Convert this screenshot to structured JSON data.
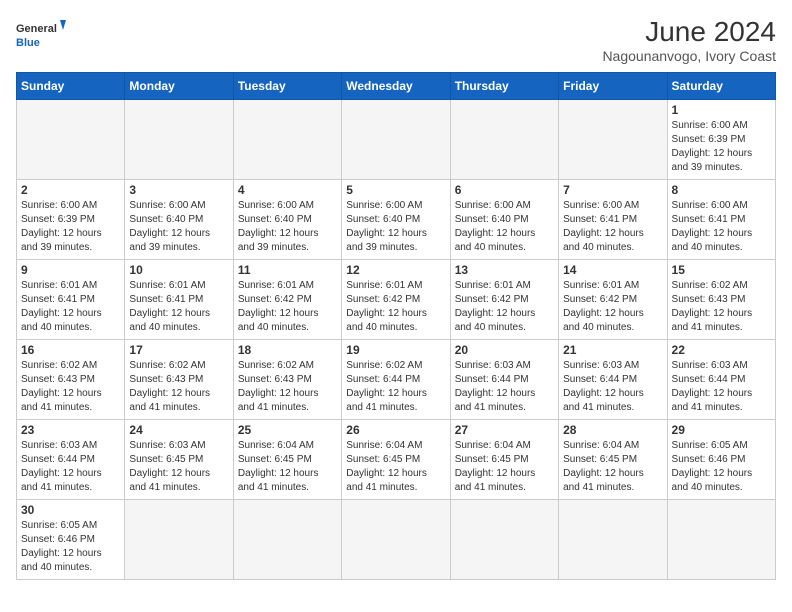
{
  "header": {
    "logo_general": "General",
    "logo_blue": "Blue",
    "title": "June 2024",
    "subtitle": "Nagounanvogo, Ivory Coast"
  },
  "weekdays": [
    "Sunday",
    "Monday",
    "Tuesday",
    "Wednesday",
    "Thursday",
    "Friday",
    "Saturday"
  ],
  "weeks": [
    [
      {
        "day": "",
        "info": "",
        "empty": true
      },
      {
        "day": "",
        "info": "",
        "empty": true
      },
      {
        "day": "",
        "info": "",
        "empty": true
      },
      {
        "day": "",
        "info": "",
        "empty": true
      },
      {
        "day": "",
        "info": "",
        "empty": true
      },
      {
        "day": "",
        "info": "",
        "empty": true
      },
      {
        "day": "1",
        "info": "Sunrise: 6:00 AM\nSunset: 6:39 PM\nDaylight: 12 hours\nand 39 minutes."
      }
    ],
    [
      {
        "day": "2",
        "info": "Sunrise: 6:00 AM\nSunset: 6:39 PM\nDaylight: 12 hours\nand 39 minutes."
      },
      {
        "day": "3",
        "info": "Sunrise: 6:00 AM\nSunset: 6:40 PM\nDaylight: 12 hours\nand 39 minutes."
      },
      {
        "day": "4",
        "info": "Sunrise: 6:00 AM\nSunset: 6:40 PM\nDaylight: 12 hours\nand 39 minutes."
      },
      {
        "day": "5",
        "info": "Sunrise: 6:00 AM\nSunset: 6:40 PM\nDaylight: 12 hours\nand 39 minutes."
      },
      {
        "day": "6",
        "info": "Sunrise: 6:00 AM\nSunset: 6:40 PM\nDaylight: 12 hours\nand 40 minutes."
      },
      {
        "day": "7",
        "info": "Sunrise: 6:00 AM\nSunset: 6:41 PM\nDaylight: 12 hours\nand 40 minutes."
      },
      {
        "day": "8",
        "info": "Sunrise: 6:00 AM\nSunset: 6:41 PM\nDaylight: 12 hours\nand 40 minutes."
      }
    ],
    [
      {
        "day": "9",
        "info": "Sunrise: 6:01 AM\nSunset: 6:41 PM\nDaylight: 12 hours\nand 40 minutes."
      },
      {
        "day": "10",
        "info": "Sunrise: 6:01 AM\nSunset: 6:41 PM\nDaylight: 12 hours\nand 40 minutes."
      },
      {
        "day": "11",
        "info": "Sunrise: 6:01 AM\nSunset: 6:42 PM\nDaylight: 12 hours\nand 40 minutes."
      },
      {
        "day": "12",
        "info": "Sunrise: 6:01 AM\nSunset: 6:42 PM\nDaylight: 12 hours\nand 40 minutes."
      },
      {
        "day": "13",
        "info": "Sunrise: 6:01 AM\nSunset: 6:42 PM\nDaylight: 12 hours\nand 40 minutes."
      },
      {
        "day": "14",
        "info": "Sunrise: 6:01 AM\nSunset: 6:42 PM\nDaylight: 12 hours\nand 40 minutes."
      },
      {
        "day": "15",
        "info": "Sunrise: 6:02 AM\nSunset: 6:43 PM\nDaylight: 12 hours\nand 41 minutes."
      }
    ],
    [
      {
        "day": "16",
        "info": "Sunrise: 6:02 AM\nSunset: 6:43 PM\nDaylight: 12 hours\nand 41 minutes."
      },
      {
        "day": "17",
        "info": "Sunrise: 6:02 AM\nSunset: 6:43 PM\nDaylight: 12 hours\nand 41 minutes."
      },
      {
        "day": "18",
        "info": "Sunrise: 6:02 AM\nSunset: 6:43 PM\nDaylight: 12 hours\nand 41 minutes."
      },
      {
        "day": "19",
        "info": "Sunrise: 6:02 AM\nSunset: 6:44 PM\nDaylight: 12 hours\nand 41 minutes."
      },
      {
        "day": "20",
        "info": "Sunrise: 6:03 AM\nSunset: 6:44 PM\nDaylight: 12 hours\nand 41 minutes."
      },
      {
        "day": "21",
        "info": "Sunrise: 6:03 AM\nSunset: 6:44 PM\nDaylight: 12 hours\nand 41 minutes."
      },
      {
        "day": "22",
        "info": "Sunrise: 6:03 AM\nSunset: 6:44 PM\nDaylight: 12 hours\nand 41 minutes."
      }
    ],
    [
      {
        "day": "23",
        "info": "Sunrise: 6:03 AM\nSunset: 6:44 PM\nDaylight: 12 hours\nand 41 minutes."
      },
      {
        "day": "24",
        "info": "Sunrise: 6:03 AM\nSunset: 6:45 PM\nDaylight: 12 hours\nand 41 minutes."
      },
      {
        "day": "25",
        "info": "Sunrise: 6:04 AM\nSunset: 6:45 PM\nDaylight: 12 hours\nand 41 minutes."
      },
      {
        "day": "26",
        "info": "Sunrise: 6:04 AM\nSunset: 6:45 PM\nDaylight: 12 hours\nand 41 minutes."
      },
      {
        "day": "27",
        "info": "Sunrise: 6:04 AM\nSunset: 6:45 PM\nDaylight: 12 hours\nand 41 minutes."
      },
      {
        "day": "28",
        "info": "Sunrise: 6:04 AM\nSunset: 6:45 PM\nDaylight: 12 hours\nand 41 minutes."
      },
      {
        "day": "29",
        "info": "Sunrise: 6:05 AM\nSunset: 6:46 PM\nDaylight: 12 hours\nand 40 minutes."
      }
    ],
    [
      {
        "day": "30",
        "info": "Sunrise: 6:05 AM\nSunset: 6:46 PM\nDaylight: 12 hours\nand 40 minutes.",
        "last": true
      },
      {
        "day": "",
        "info": "",
        "empty": true,
        "last": true
      },
      {
        "day": "",
        "info": "",
        "empty": true,
        "last": true
      },
      {
        "day": "",
        "info": "",
        "empty": true,
        "last": true
      },
      {
        "day": "",
        "info": "",
        "empty": true,
        "last": true
      },
      {
        "day": "",
        "info": "",
        "empty": true,
        "last": true
      },
      {
        "day": "",
        "info": "",
        "empty": true,
        "last": true
      }
    ]
  ]
}
